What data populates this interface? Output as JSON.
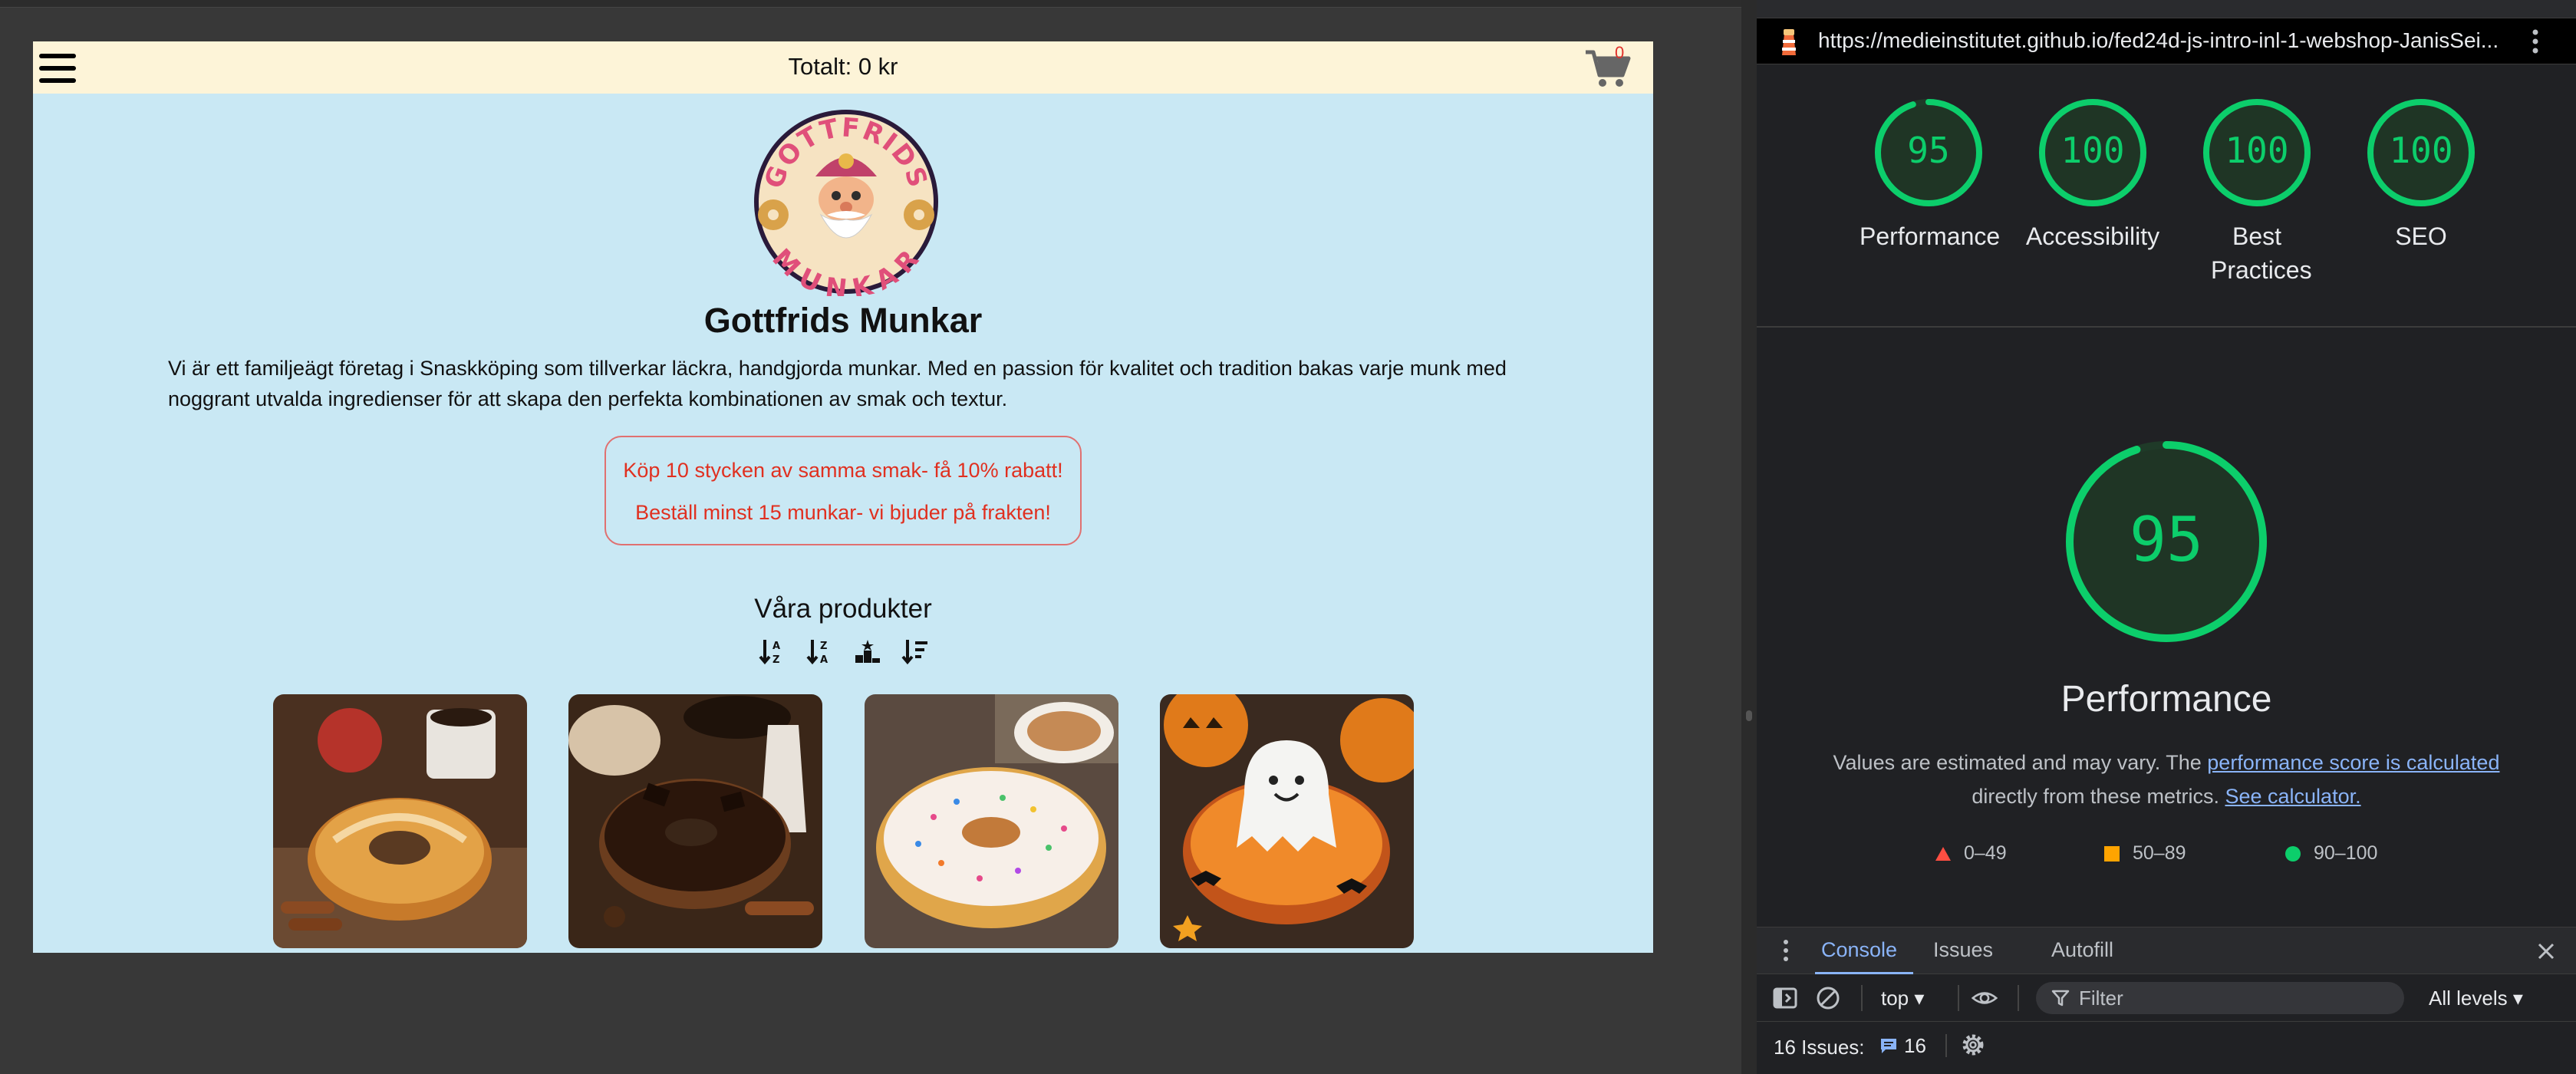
{
  "site": {
    "header": {
      "total": "Totalt: 0 kr",
      "cart_count": "0"
    },
    "title": "Gottfrids Munkar",
    "logo": {
      "top_text": "GOTTFRIDS",
      "bottom_text": "MUNKAR"
    },
    "description": "Vi är ett familjeägt företag i Snaskköping som tillverkar läckra, handgjorda munkar. Med en passion för kvalitet och tradition bakas varje munk med noggrant utvalda ingredienser för att skapa den perfekta kombinationen av smak och textur.",
    "offers": [
      "Köp 10 stycken av samma smak- få 10% rabatt!",
      "Beställ minst 15 munkar- vi bjuder på frakten!"
    ],
    "products_heading": "Våra produkter",
    "sort_icons": [
      "sort-alpha-asc-icon",
      "sort-alpha-desc-icon",
      "sort-rating-icon",
      "sort-price-icon"
    ],
    "colors": {
      "page_bg": "#c9e8f4",
      "header_bg": "#fdf4d8",
      "offer_text": "#e03020"
    }
  },
  "devtools": {
    "url": "https://medieinstitutet.github.io/fed24d-js-intro-inl-1-webshop-JanisSei...",
    "scores": [
      {
        "value": "95",
        "label": "Performance"
      },
      {
        "value": "100",
        "label": "Accessibility"
      },
      {
        "value": "100",
        "label": "Best Practices"
      },
      {
        "value": "100",
        "label": "SEO"
      }
    ],
    "main_score": {
      "value": "95",
      "title": "Performance"
    },
    "disclaimer": {
      "before": "Values are estimated and may vary. The ",
      "link1": "performance score is calculated",
      "middle": " directly from these metrics. ",
      "link2": "See calculator."
    },
    "legend": [
      "0–49",
      "50–89",
      "90–100"
    ],
    "tabs": [
      "Console",
      "Issues",
      "Autofill"
    ],
    "context": "top",
    "filter_placeholder": "Filter",
    "levels": "All levels",
    "issues_label": "16 Issues:",
    "issues_count": "16",
    "colors": {
      "good": "#0cce6b",
      "average": "#ffa400",
      "fail": "#ff4e42",
      "accent": "#8ab4f8"
    }
  }
}
